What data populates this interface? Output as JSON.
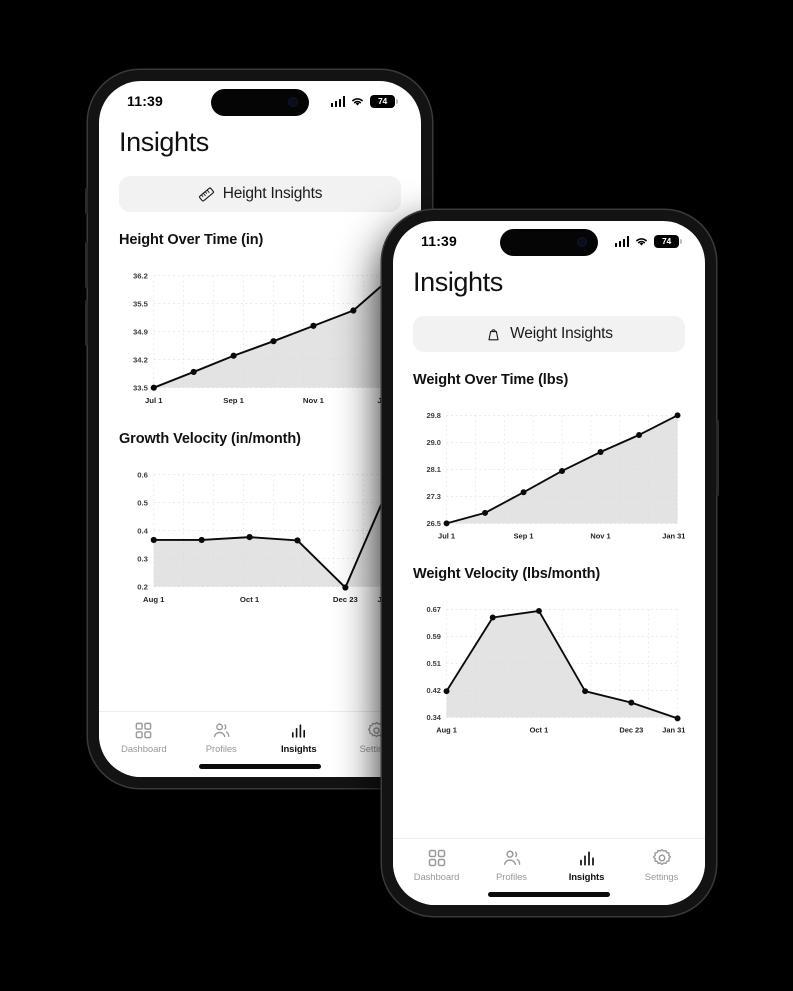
{
  "statusbar": {
    "time": "11:39",
    "battery": "74",
    "signal_icon": "cellular-signal-icon",
    "wifi_icon": "wifi-icon",
    "battery_icon": "battery-icon"
  },
  "phones": {
    "back": {
      "page_title": "Insights",
      "pill": {
        "label": "Height Insights",
        "icon": "ruler-icon"
      },
      "charts": [
        {
          "title": "Height Over Time (in)",
          "type": "line",
          "ylabels": [
            "36.2",
            "35.5",
            "34.9",
            "34.2",
            "33.5"
          ],
          "xlabels": [
            "Jul 1",
            "Sep 1",
            "Nov 1",
            "Jan 31"
          ],
          "values": [
            33.5,
            33.88,
            34.27,
            34.62,
            34.99,
            35.36,
            36.2
          ],
          "ymin": 33.5,
          "ymax": 36.2
        },
        {
          "title": "Growth Velocity (in/month)",
          "type": "line",
          "ylabels": [
            "0.6",
            "0.5",
            "0.4",
            "0.3",
            "0.2"
          ],
          "xlabels": [
            "Aug 1",
            "Oct 1",
            "Dec 23",
            "Jan 31"
          ],
          "values": [
            0.367,
            0.367,
            0.377,
            0.365,
            0.197,
            0.593
          ],
          "ymin": 0.2,
          "ymax": 0.6
        }
      ]
    },
    "front": {
      "page_title": "Insights",
      "pill": {
        "label": "Weight Insights",
        "icon": "weight-icon"
      },
      "charts": [
        {
          "title": "Weight Over Time (lbs)",
          "type": "line",
          "ylabels": [
            "29.8",
            "29.0",
            "28.1",
            "27.3",
            "26.5"
          ],
          "xlabels": [
            "Jul 1",
            "Sep 1",
            "Nov 1",
            "Jan 31"
          ],
          "values": [
            26.5,
            26.82,
            27.45,
            28.1,
            28.68,
            29.2,
            29.8
          ],
          "ymin": 26.5,
          "ymax": 29.8
        },
        {
          "title": "Weight Velocity (lbs/month)",
          "type": "line",
          "ylabels": [
            "0.67",
            "0.59",
            "0.51",
            "0.42",
            "0.34"
          ],
          "xlabels": [
            "Aug 1",
            "Oct 1",
            "Dec 23",
            "Jan 31"
          ],
          "values": [
            0.42,
            0.645,
            0.665,
            0.42,
            0.385,
            0.337
          ],
          "ymin": 0.34,
          "ymax": 0.67
        }
      ]
    }
  },
  "tabbar": {
    "items": [
      {
        "label": "Dashboard",
        "icon": "grid-icon",
        "active": false
      },
      {
        "label": "Profiles",
        "icon": "people-icon",
        "active": false
      },
      {
        "label": "Insights",
        "icon": "bar-chart-icon",
        "active": true
      },
      {
        "label": "Settings",
        "icon": "gear-icon",
        "active": false
      }
    ]
  },
  "chart_data": [
    {
      "type": "line",
      "title": "Height Over Time (in)",
      "xlabel": "",
      "ylabel": "in",
      "tick_labels_y": [
        "33.5",
        "34.2",
        "34.9",
        "35.5",
        "36.2"
      ],
      "tick_labels_x": [
        "Jul 1",
        "Sep 1",
        "Nov 1",
        "Jan 31"
      ],
      "ylim": [
        33.5,
        36.2
      ],
      "grid": true,
      "legend": "none",
      "x": [
        "Jul 1",
        "Aug 1",
        "Sep 1",
        "Oct 1",
        "Nov 1",
        "Dec 1",
        "Jan 31"
      ],
      "values": [
        33.5,
        33.88,
        34.27,
        34.62,
        34.99,
        35.36,
        36.2
      ]
    },
    {
      "type": "line",
      "title": "Growth Velocity (in/month)",
      "xlabel": "",
      "ylabel": "in/month",
      "tick_labels_y": [
        "0.2",
        "0.3",
        "0.4",
        "0.5",
        "0.6"
      ],
      "tick_labels_x": [
        "Aug 1",
        "Oct 1",
        "Dec 23",
        "Jan 31"
      ],
      "ylim": [
        0.2,
        0.6
      ],
      "grid": true,
      "legend": "none",
      "x": [
        "Aug 1",
        "Sep 1",
        "Oct 1",
        "Nov 1",
        "Dec 23",
        "Jan 31"
      ],
      "values": [
        0.367,
        0.367,
        0.377,
        0.365,
        0.197,
        0.593
      ]
    },
    {
      "type": "line",
      "title": "Weight Over Time (lbs)",
      "xlabel": "",
      "ylabel": "lbs",
      "tick_labels_y": [
        "26.5",
        "27.3",
        "28.1",
        "29.0",
        "29.8"
      ],
      "tick_labels_x": [
        "Jul 1",
        "Sep 1",
        "Nov 1",
        "Jan 31"
      ],
      "ylim": [
        26.5,
        29.8
      ],
      "grid": true,
      "legend": "none",
      "x": [
        "Jul 1",
        "Aug 1",
        "Sep 1",
        "Oct 1",
        "Nov 1",
        "Dec 1",
        "Jan 31"
      ],
      "values": [
        26.5,
        26.82,
        27.45,
        28.1,
        28.68,
        29.2,
        29.8
      ]
    },
    {
      "type": "line",
      "title": "Weight Velocity (lbs/month)",
      "xlabel": "",
      "ylabel": "lbs/month",
      "tick_labels_y": [
        "0.34",
        "0.42",
        "0.51",
        "0.59",
        "0.67"
      ],
      "tick_labels_x": [
        "Aug 1",
        "Oct 1",
        "Dec 23",
        "Jan 31"
      ],
      "ylim": [
        0.34,
        0.67
      ],
      "grid": true,
      "legend": "none",
      "x": [
        "Aug 1",
        "Sep 1",
        "Oct 1",
        "Nov 1",
        "Dec 23",
        "Jan 31"
      ],
      "values": [
        0.42,
        0.645,
        0.665,
        0.42,
        0.385,
        0.337
      ]
    }
  ]
}
